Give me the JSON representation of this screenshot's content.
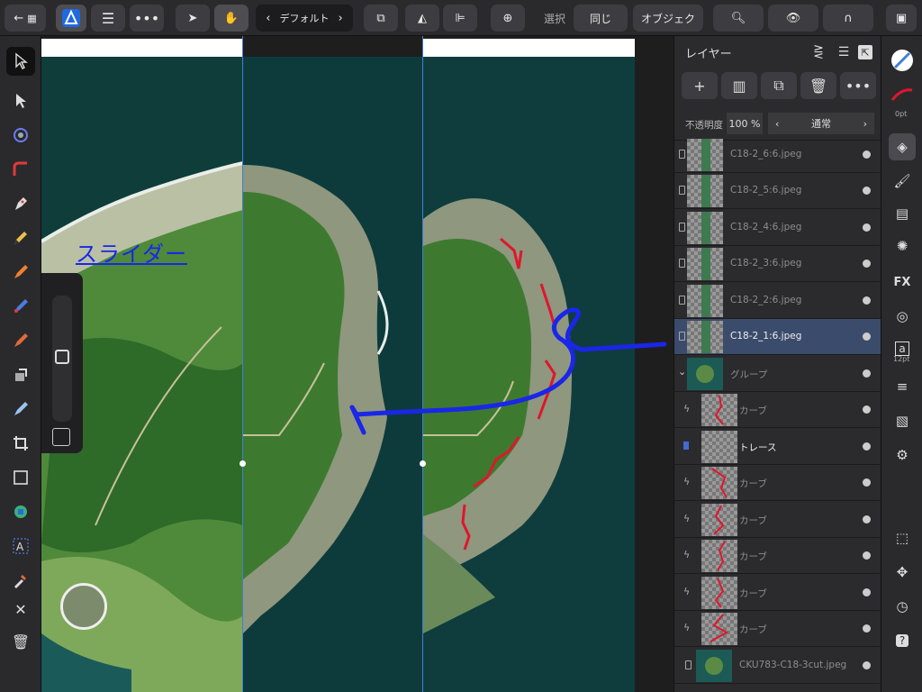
{
  "toolbar": {
    "back_label": "←",
    "context_preset": "デフォルト",
    "select_label": "選択",
    "same_label": "同じ",
    "object_label": "オブジェク"
  },
  "canvas": {
    "slider_annotation": "スライダー"
  },
  "layers_panel": {
    "title": "レイヤー",
    "opacity_label": "不透明度",
    "opacity_value": "100 %",
    "blend_mode": "通常",
    "layers": [
      {
        "name": "C18-2_6:6.jpeg",
        "selected": false
      },
      {
        "name": "C18-2_5:6.jpeg",
        "selected": false
      },
      {
        "name": "C18-2_4:6.jpeg",
        "selected": false
      },
      {
        "name": "C18-2_3:6.jpeg",
        "selected": false
      },
      {
        "name": "C18-2_2:6.jpeg",
        "selected": false
      },
      {
        "name": "C18-2_1:6.jpeg",
        "selected": true
      },
      {
        "name": "グループ",
        "selected": false
      },
      {
        "name": "カーブ",
        "selected": false
      },
      {
        "name": "トレース",
        "selected": false
      },
      {
        "name": "カーブ",
        "selected": false
      },
      {
        "name": "カーブ",
        "selected": false
      },
      {
        "name": "カーブ",
        "selected": false
      },
      {
        "name": "カーブ",
        "selected": false
      },
      {
        "name": "カーブ",
        "selected": false
      },
      {
        "name": "CKU783-C18-3cut.jpeg",
        "selected": false
      }
    ]
  },
  "studio": {
    "stroke_width": "0pt",
    "text_size": "12pt"
  },
  "colors": {
    "accent": "#3f7fd6",
    "annotation_blue": "#1a26e8",
    "annotation_red": "#e0162b",
    "selected_layer": "#3b4b6b"
  }
}
